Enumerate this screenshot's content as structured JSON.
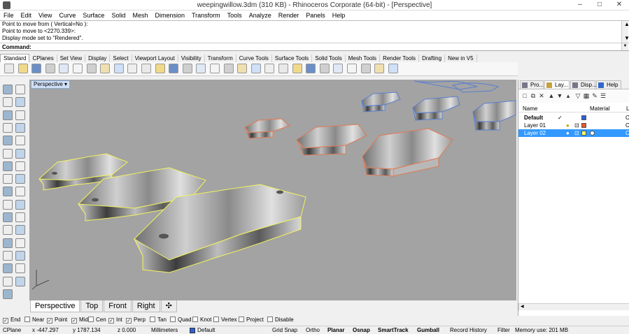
{
  "window": {
    "title": "weepingwillow.3dm (310 KB) - Rhinoceros Corporate (64-bit) - [Perspective]",
    "minimize": "–",
    "maximize": "□",
    "close": "✕"
  },
  "menu": [
    "File",
    "Edit",
    "View",
    "Curve",
    "Surface",
    "Solid",
    "Mesh",
    "Dimension",
    "Transform",
    "Tools",
    "Analyze",
    "Render",
    "Panels",
    "Help"
  ],
  "command_history": [
    "Point to move from ( Vertical=No ):",
    "Point to move to <2270.339>:",
    "Display mode set to \"Rendered\"."
  ],
  "command_prompt": "Command:",
  "toolbar_tabs": [
    "Standard",
    "CPlanes",
    "Set View",
    "Display",
    "Select",
    "Viewport Layout",
    "Visibility",
    "Transform",
    "Curve Tools",
    "Surface Tools",
    "Solid Tools",
    "Mesh Tools",
    "Render Tools",
    "Drafting",
    "New in V5"
  ],
  "toolbar_icons": [
    "new-file-icon",
    "open-file-icon",
    "save-icon",
    "print-icon",
    "import-icon",
    "cut-icon",
    "copy-icon",
    "paste-icon",
    "undo-icon",
    "pan-icon",
    "rotate-view-icon",
    "zoom-dynamic-icon",
    "zoom-window-icon",
    "zoom-extents-icon",
    "zoom-selected-icon",
    "undo-view-icon",
    "four-views-icon",
    "grid-icon",
    "osnap-icon",
    "record-icon",
    "light-icon",
    "lock-icon",
    "material-icon",
    "color-icon",
    "render-sphere-icon",
    "render-preview-icon",
    "environment-icon",
    "options-icon",
    "help-icon"
  ],
  "viewport": {
    "label": "Perspective"
  },
  "viewport_tabs": [
    "Perspective",
    "Top",
    "Front",
    "Right",
    "✣"
  ],
  "osnaps": [
    {
      "label": "End",
      "checked": true
    },
    {
      "label": "Near",
      "checked": false
    },
    {
      "label": "Point",
      "checked": true
    },
    {
      "label": "Mid",
      "checked": true
    },
    {
      "label": "Cen",
      "checked": false
    },
    {
      "label": "Int",
      "checked": true
    },
    {
      "label": "Perp",
      "checked": true
    },
    {
      "label": "Tan",
      "checked": false
    },
    {
      "label": "Quad",
      "checked": false
    },
    {
      "label": "Knot",
      "checked": false
    },
    {
      "label": "Vertex",
      "checked": false
    },
    {
      "label": "Project",
      "checked": false
    },
    {
      "label": "Disable",
      "checked": false
    }
  ],
  "status": {
    "cplane": "CPlane",
    "x": "x -447.297",
    "y": "y 1787.134",
    "z": "z 0.000",
    "units": "Millimeters",
    "layer": "Default",
    "grid_snap": "Grid Snap",
    "ortho": "Ortho",
    "planar": "Planar",
    "osnap": "Osnap",
    "smarttrack": "SmartTrack",
    "gumball": "Gumball",
    "record_history": "Record History",
    "filter": "Filter",
    "memory": "Memory use: 201 MB"
  },
  "panel": {
    "tabs": [
      "Pro...",
      "Lay...",
      "Disp...",
      "Help"
    ],
    "col_name": "Name",
    "col_material": "Material",
    "col_extra": "L",
    "layers": [
      {
        "name": "Default",
        "current": "✓",
        "color": "#2b5fd9",
        "bold": true
      },
      {
        "name": "Layer 01",
        "current": "",
        "color": "#e8562b",
        "bold": false
      },
      {
        "name": "Layer 02",
        "current": "",
        "color": "#ffff66",
        "bold": false
      }
    ],
    "row_suffix": "C"
  },
  "colors": {
    "viewport_bg": "#a3a3a3",
    "selected_layer": "#3399ff",
    "yellow_edge": "#f2f260",
    "orange_edge": "#e07a55",
    "blue_edge": "#5a7fd0"
  }
}
